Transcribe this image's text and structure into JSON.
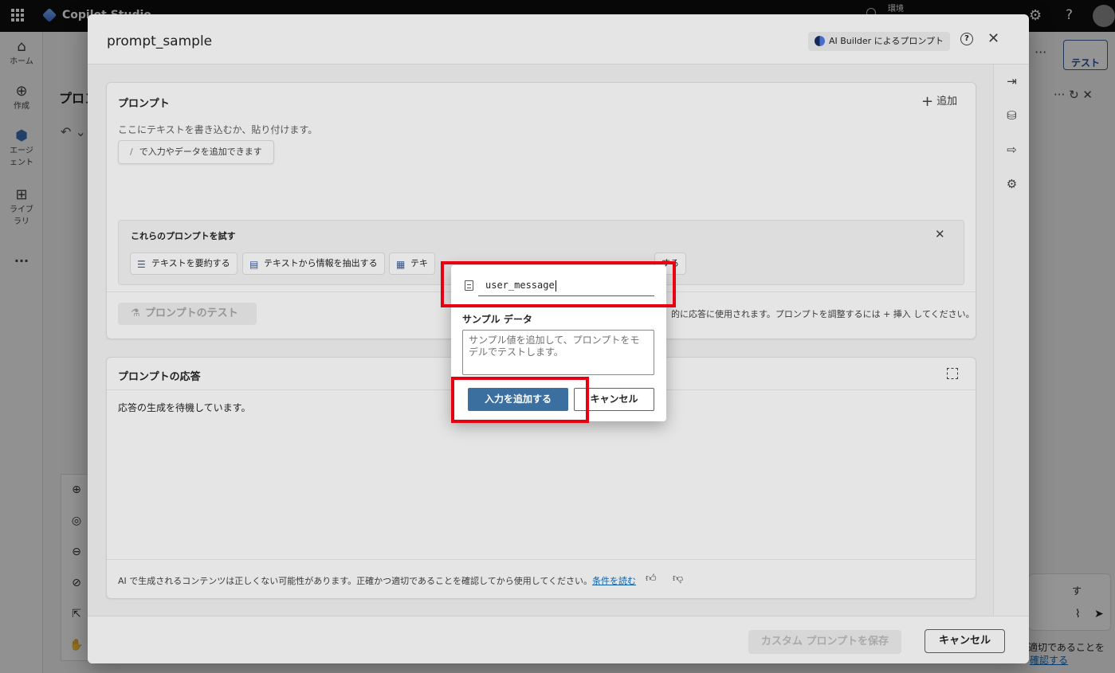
{
  "topbar": {
    "app_name": "Copilot Studio",
    "env_label": "環境"
  },
  "rail": {
    "items": [
      {
        "label": "ホーム",
        "icon": "home-icon"
      },
      {
        "label": "作成",
        "icon": "plus-icon"
      },
      {
        "label": "エージェント",
        "icon": "agent-icon"
      },
      {
        "label": "ライブラリ",
        "icon": "library-icon"
      }
    ],
    "more": "..."
  },
  "bg": {
    "title": "プロン",
    "test_label": "テスト",
    "chat_placeholder_tail": "す",
    "chat_text": "適切であることを",
    "chat_link": "確認する"
  },
  "dialog": {
    "title": "prompt_sample",
    "ai_builder": "AI Builder によるプロンプト",
    "prompt_card": {
      "heading": "プロンプト",
      "add_label": "追加",
      "placeholder": "ここにテキストを書き込むか、貼り付けます。",
      "slash_hint": "で入力やデータを追加できます",
      "suggestions": {
        "heading": "これらのプロンプトを試す",
        "chips": [
          "テキストを要約する",
          "テキストから情報を抽出する",
          "テキ",
          "する"
        ]
      },
      "test_button": "プロンプトのテスト",
      "insert_note": "的に応答に使用されます。プロンプトを調整するには + 挿入 してください。"
    },
    "response_card": {
      "heading": "プロンプトの応答",
      "waiting": "応答の生成を待機しています。",
      "disclaimer": "AI で生成されるコンテンツは正しくない可能性があります。正確かつ適切であることを確認してから使用してください。",
      "terms_link": "条件を読む"
    },
    "footer": {
      "save": "カスタム プロンプトを保存",
      "cancel": "キャンセル"
    }
  },
  "popup": {
    "input_value": "user_message",
    "sample_label": "サンプル データ",
    "sample_placeholder": "サンプル値を追加して、プロンプトをモデルでテストします。",
    "add_button": "入力を追加する",
    "cancel_button": "キャンセル"
  },
  "colors": {
    "accent": "#3b6fa0",
    "highlight": "#e60012"
  }
}
